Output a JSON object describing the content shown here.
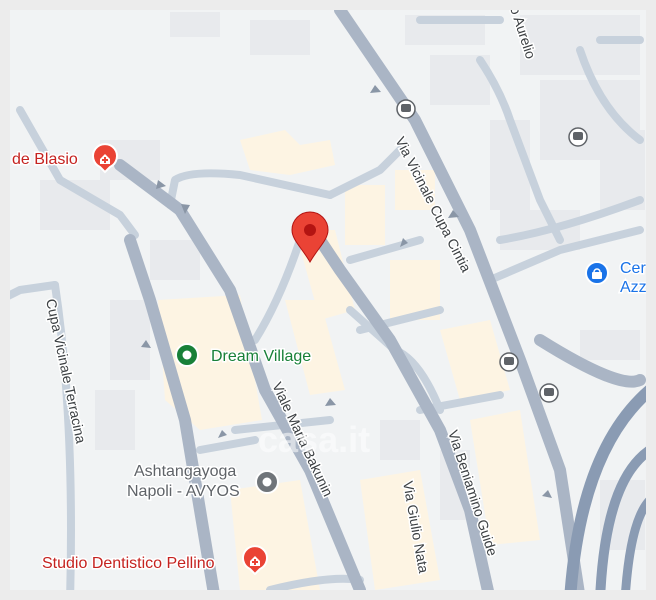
{
  "colors": {
    "background": "#f1f3f4",
    "building": "#e8eaed",
    "road_major": "#aab5c5",
    "road_minor": "#c7d1dc",
    "block_highlight": "#fdf4e3",
    "pin": "#ea4335",
    "poi_red": "#c5221f",
    "poi_green": "#188038",
    "poi_blue": "#1a73e8",
    "frame": "#ececec"
  },
  "streets": {
    "via_vicinale_cupa_cintia": "Via Vicinale Cupa Cintia",
    "viale_maria_bakunin": "Viale Maria Bakunin",
    "via_beniamino_guide": "Via Beniamino Guide",
    "via_giulio_nata": "Via Giulio Nata",
    "cupa_vicinale_terracina": "Cupa Vicinale Terracina",
    "aurelio": "o Aurelio"
  },
  "pois": {
    "de_blasio": {
      "label": "de Blasio",
      "icon": "medical-icon"
    },
    "dream_village": {
      "label": "Dream Village",
      "icon": "lodging-icon"
    },
    "ashtangayoga_line1": "Ashtangayoga",
    "ashtangayoga_line2": "Napoli - AVYOS",
    "ashtangayoga_icon": "place-icon",
    "studio_pellino": {
      "label": "Studio Dentistico Pellino",
      "icon": "medical-icon"
    },
    "shop_line1": "Cer",
    "shop_line2": "Azz",
    "shop_icon": "shopping-bag-icon"
  },
  "markers": {
    "location_pin": "location-pin-icon",
    "bus_stop": "bus-stop-icon"
  },
  "watermark": "casa.it"
}
